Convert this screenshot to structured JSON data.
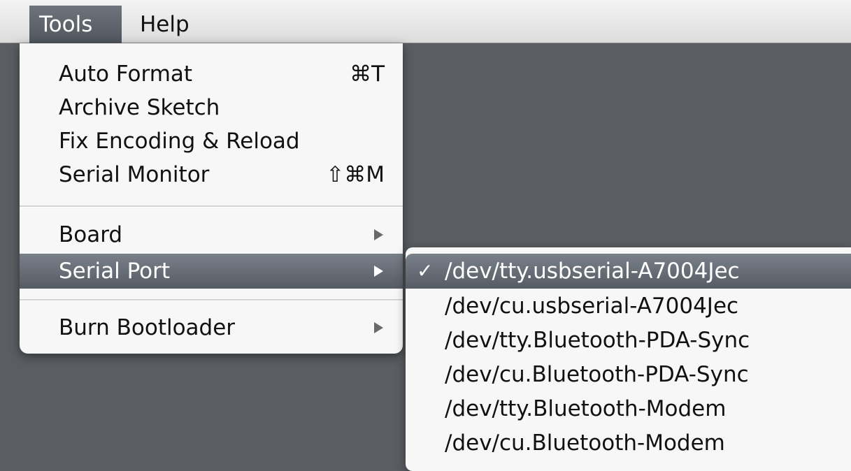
{
  "menubar": {
    "items": [
      {
        "label": "Tools"
      },
      {
        "label": "Help"
      }
    ]
  },
  "tools_menu": {
    "items": [
      {
        "label": "Auto Format",
        "shortcut": "⌘T"
      },
      {
        "label": "Archive Sketch",
        "shortcut": ""
      },
      {
        "label": "Fix Encoding & Reload",
        "shortcut": ""
      },
      {
        "label": "Serial Monitor",
        "shortcut": "⇧⌘M"
      },
      {
        "label": "Board",
        "submenu": true
      },
      {
        "label": "Serial Port",
        "submenu": true,
        "highlighted": true
      },
      {
        "label": "Burn Bootloader",
        "submenu": true
      }
    ]
  },
  "serial_port_menu": {
    "check_glyph": "✓",
    "items": [
      {
        "label": "/dev/tty.usbserial-A7004Jec",
        "checked": true
      },
      {
        "label": "/dev/cu.usbserial-A7004Jec"
      },
      {
        "label": "/dev/tty.Bluetooth-PDA-Sync"
      },
      {
        "label": "/dev/cu.Bluetooth-PDA-Sync"
      },
      {
        "label": "/dev/tty.Bluetooth-Modem"
      },
      {
        "label": "/dev/cu.Bluetooth-Modem"
      }
    ]
  },
  "colors": {
    "highlight": "#60666e",
    "menu_background": "#f7f7f7",
    "desktop_background": "#5a5d62"
  }
}
